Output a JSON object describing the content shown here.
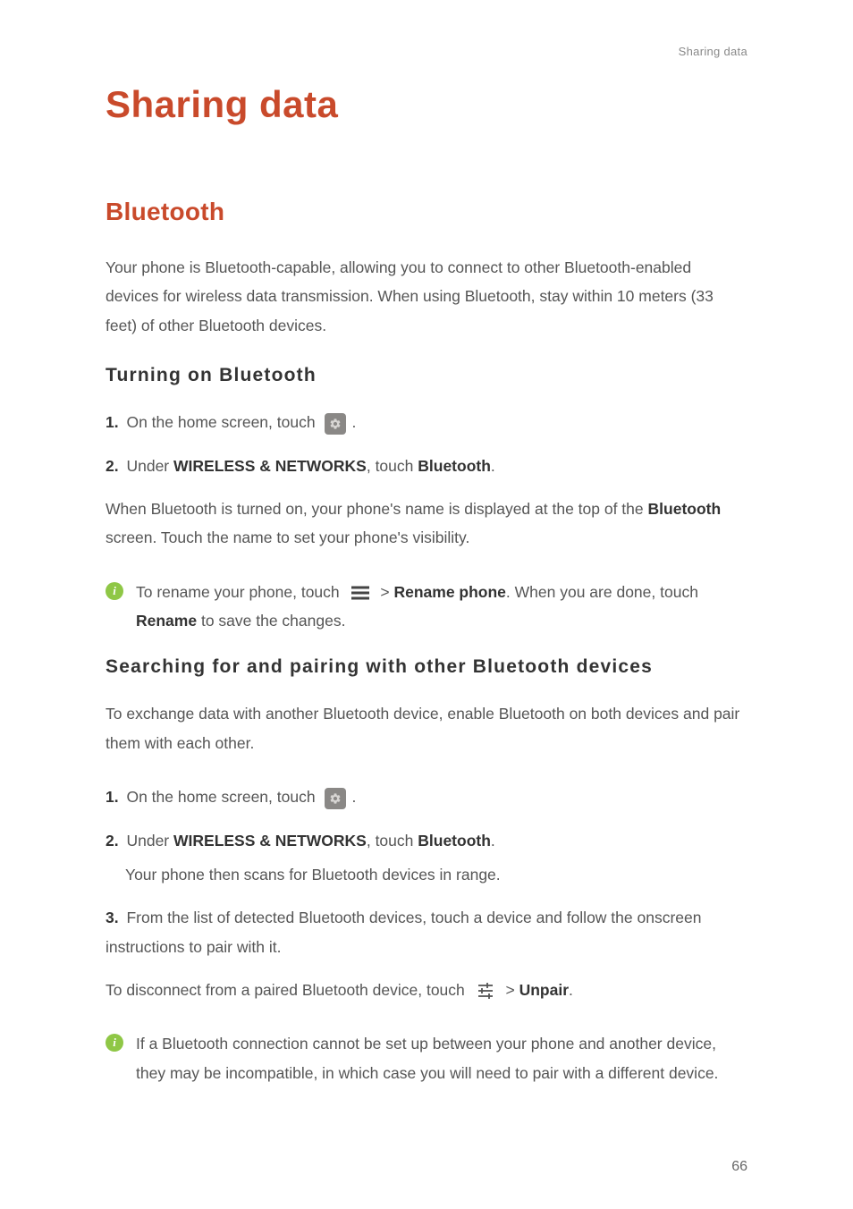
{
  "header": {
    "section_label": "Sharing data"
  },
  "page": {
    "title": "Sharing data",
    "number": "66"
  },
  "bluetooth": {
    "heading": "Bluetooth",
    "intro": "Your phone is Bluetooth-capable, allowing you to connect to other Bluetooth-enabled devices for wireless data transmission. When using Bluetooth, stay within 10 meters (33 feet) of other Bluetooth devices.",
    "turning_on": {
      "heading": "Turning on Bluetooth",
      "step1_num": "1.",
      "step1_text": " On the home screen, touch ",
      "step1_after": ".",
      "step2_num": "2.",
      "step2_a": " Under ",
      "step2_b": "WIRELESS & NETWORKS",
      "step2_c": ", touch ",
      "step2_d": "Bluetooth",
      "step2_e": ".",
      "result_a": "When Bluetooth is turned on, your phone's name is displayed at the top of the ",
      "result_b": "Bluetooth",
      "result_c": " screen. Touch the name to set your phone's visibility.",
      "info_a": "To rename your phone, touch ",
      "info_b": " > ",
      "info_c": "Rename phone",
      "info_d": ". When you are done, touch ",
      "info_e": "Rename",
      "info_f": " to save the changes."
    },
    "searching": {
      "heading": "Searching for and pairing with other Bluetooth devices",
      "intro": "To exchange data with another Bluetooth device, enable Bluetooth on both devices and pair them with each other.",
      "step1_num": "1.",
      "step1_text": " On the home screen, touch ",
      "step1_after": ".",
      "step2_num": "2.",
      "step2_a": " Under ",
      "step2_b": "WIRELESS & NETWORKS",
      "step2_c": ", touch ",
      "step2_d": "Bluetooth",
      "step2_e": ".",
      "step2_sub": "Your phone then scans for Bluetooth devices in range.",
      "step3_num": "3.",
      "step3_text": " From the list of detected Bluetooth devices, touch a device and follow the onscreen instructions to pair with it.",
      "disconnect_a": "To disconnect from a paired Bluetooth device, touch ",
      "disconnect_b": " > ",
      "disconnect_c": "Unpair",
      "disconnect_d": ".",
      "info_text": "If a Bluetooth connection cannot be set up between your phone and another device, they may be incompatible, in which case you will need to pair with a different device."
    }
  }
}
